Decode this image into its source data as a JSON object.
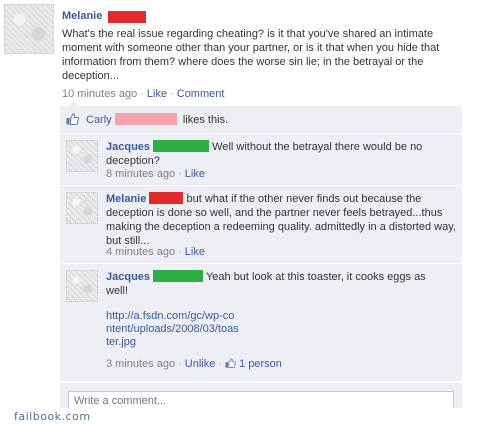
{
  "post": {
    "author": "Melanie",
    "body": "What's the real issue regarding cheating? is it that you've shared an intimate moment with someone other than your partner, or is it that when you hide that information from them? where does the worse sin lie; in the betrayal or the deception...",
    "time": "10 minutes ago",
    "like_label": "Like",
    "comment_label": "Comment"
  },
  "likes": {
    "name": "Carly",
    "suffix": "likes this."
  },
  "comments": [
    {
      "author": "Jacques",
      "text": "Well without the betrayal there would be no deception?",
      "time": "8 minutes ago",
      "like_label": "Like"
    },
    {
      "author": "Melanie",
      "text": "but what if the other never finds out because the deception is done so well, and the partner never feels betrayed...thus making the deception a redeeming quality. admittedly in a distorted way, but still...",
      "time": "4 minutes ago",
      "like_label": "Like"
    },
    {
      "author": "Jacques",
      "text": "Yeah but look at this toaster, it cooks eggs as well!",
      "link_lines": [
        "http://a.fsdn.com/gc/wp-co",
        "ntent/uploads/2008/03/toas",
        "ter.jpg"
      ],
      "time": "3 minutes ago",
      "unlike_label": "Unlike",
      "like_count": "1 person"
    }
  ],
  "write_comment": {
    "placeholder": "Write a comment..."
  },
  "watermark": "failbook.com",
  "colors": {
    "link": "#3b5998",
    "ufi_bg": "#edeff4",
    "redact_red": "#e22b2b",
    "redact_green": "#2fae44",
    "redact_pink": "#f4a3ad"
  }
}
